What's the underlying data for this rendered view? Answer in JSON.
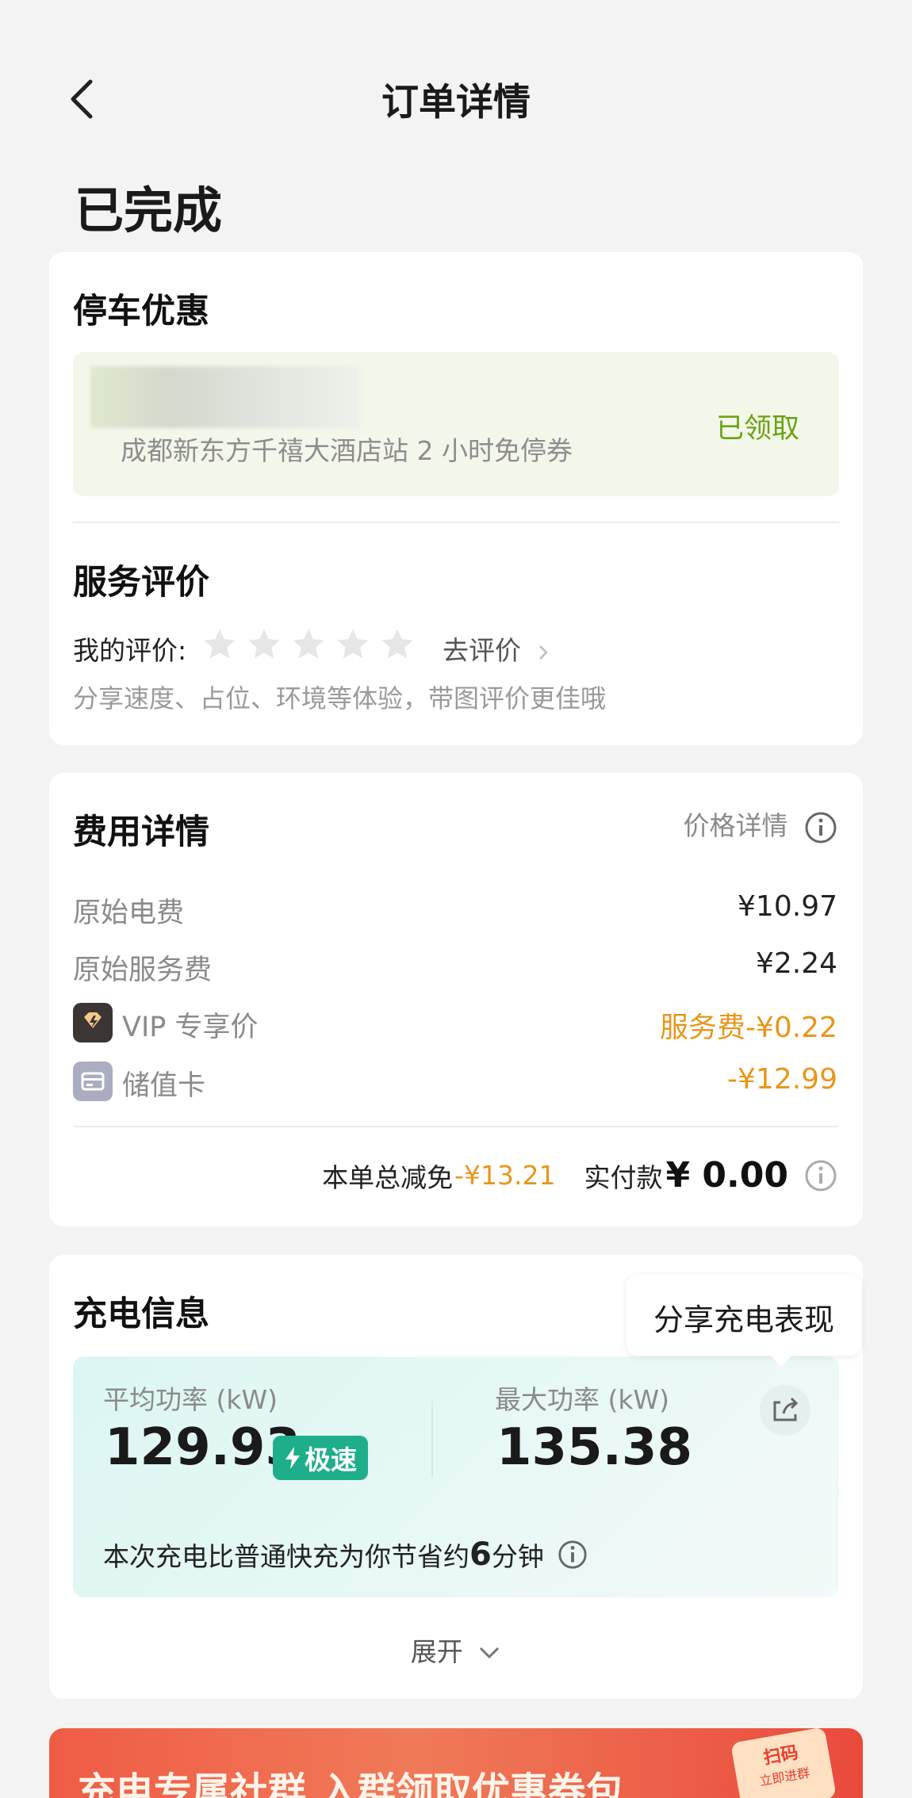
{
  "header": {
    "title": "订单详情"
  },
  "status": "已完成",
  "parking": {
    "title": "停车优惠",
    "coupon_desc": "成都新东方千禧大酒店站 2 小时免停券",
    "coupon_status": "已领取"
  },
  "review": {
    "title": "服务评价",
    "my_label": "我的评价:",
    "rating": 0,
    "rating_max": 5,
    "go_label": "去评价",
    "hint": "分享速度、占位、环境等体验，带图评价更佳哦"
  },
  "fees": {
    "title": "费用详情",
    "price_detail_label": "价格详情",
    "rows": [
      {
        "label": "原始电费",
        "value": "¥10.97"
      },
      {
        "label": "原始服务费",
        "value": "¥2.24"
      },
      {
        "label": "VIP 专享价",
        "value": "服务费-¥0.22"
      },
      {
        "label": "储值卡",
        "value": "-¥12.99"
      }
    ],
    "total_discount_label": "本单总减免",
    "total_discount_value": "-¥13.21",
    "paid_label": "实付款",
    "paid_value": "¥ 0.00"
  },
  "charging": {
    "title": "充电信息",
    "share_tooltip": "分享充电表现",
    "avg_label": "平均功率 (kW)",
    "avg_value": "129.93",
    "fast_badge": "极速",
    "max_label": "最大功率 (kW)",
    "max_value": "135.38",
    "saving_prefix": "本次充电比普通快充为你节省约",
    "saving_number": "6",
    "saving_suffix": "分钟",
    "expand_label": "展开"
  },
  "banner": {
    "text": "充电专属社群 入群领取优惠券包",
    "badge_line1": "扫码",
    "badge_line2": "立即进群"
  },
  "colors": {
    "accent_green": "#6aa312",
    "orange": "#e8961b",
    "teal": "#1fae8c"
  }
}
